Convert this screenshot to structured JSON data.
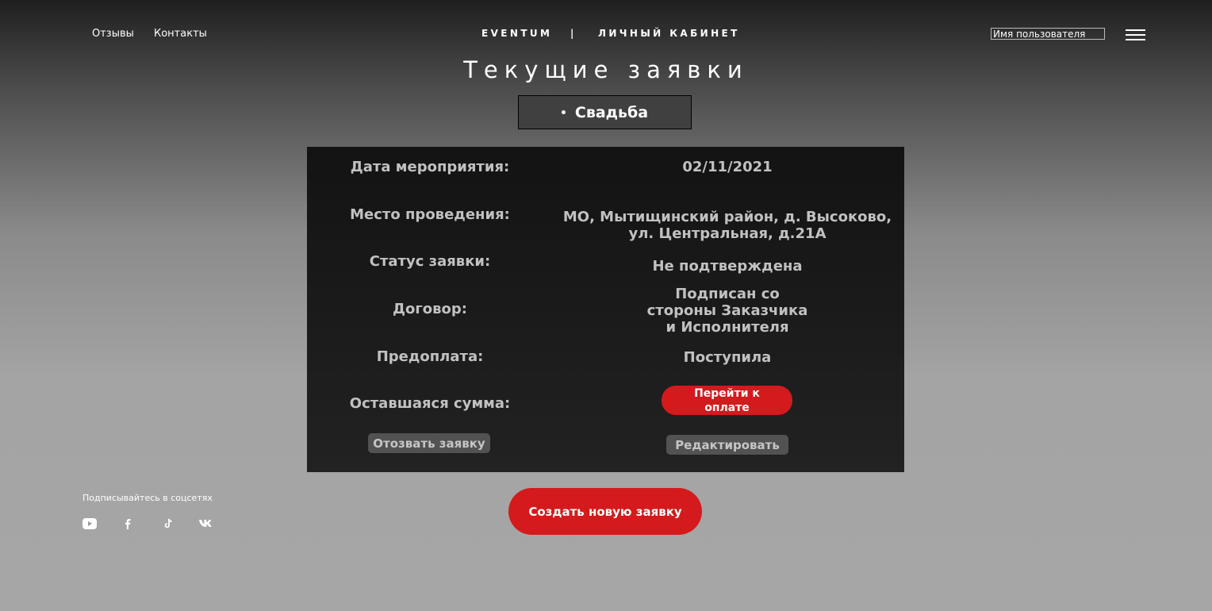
{
  "nav": {
    "reviews": "Отзывы",
    "contacts": "Контакты",
    "brand": "EVENTUM",
    "separator": "|",
    "cabinet": "ЛИЧНЫЙ КАБИНЕТ",
    "username_placeholder": "Имя пользователя"
  },
  "page": {
    "title": "Текущие заявки",
    "category": "Свадьба"
  },
  "details": {
    "date_label": "Дата мероприятия:",
    "date_value": "02/11/2021",
    "place_label": "Место проведения:",
    "place_value_line1": "МО, Мытищинский район, д. Высоково,",
    "place_value_line2": "ул. Центральная, д.21А",
    "status_label": "Статус заявки:",
    "status_value": "Не подтверждена",
    "contract_label": "Договор:",
    "contract_value_line1": "Подписан со",
    "contract_value_line2": "стороны Заказчика",
    "contract_value_line3": "и Исполнителя",
    "prepayment_label": "Предоплата:",
    "prepayment_value": "Поступила",
    "remaining_label": "Оставшаяся сумма:",
    "pay_button_line1": "Перейти к",
    "pay_button_line2": "оплате",
    "withdraw_button": "Отозвать заявку",
    "edit_button": "Редактировать"
  },
  "actions": {
    "create_button": "Создать новую заявку"
  },
  "social": {
    "title": "Подписывайтесь в соцсетях",
    "icons": [
      "youtube-icon",
      "facebook-icon",
      "tiktok-icon",
      "vk-icon"
    ]
  },
  "colors": {
    "accent_red": "#d41a1d",
    "panel_bg": "#1a1a1a",
    "muted_text": "#c1c1c1"
  }
}
